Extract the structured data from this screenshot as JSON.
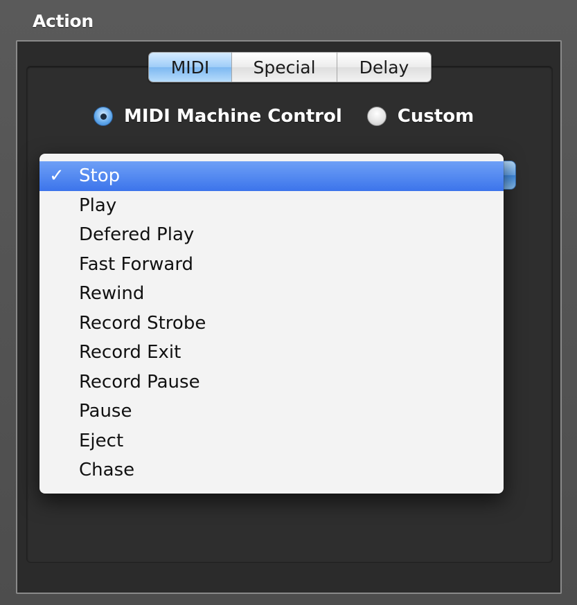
{
  "section": {
    "title": "Action"
  },
  "tabs": {
    "items": [
      {
        "label": "MIDI",
        "selected": true
      },
      {
        "label": "Special",
        "selected": false
      },
      {
        "label": "Delay",
        "selected": false
      }
    ]
  },
  "radio_group": {
    "options": [
      {
        "label": "MIDI Machine Control",
        "checked": true
      },
      {
        "label": "Custom",
        "checked": false
      }
    ]
  },
  "menu": {
    "check_mark": "✓",
    "selected_index": 0,
    "items": [
      "Stop",
      "Play",
      "Defered Play",
      "Fast Forward",
      "Rewind",
      "Record Strobe",
      "Record Exit",
      "Record Pause",
      "Pause",
      "Eject",
      "Chase"
    ]
  },
  "colors": {
    "panel_bg": "#555555",
    "highlight": "#3c74eb",
    "text_light": "#ffffff",
    "menu_bg": "#fafafa"
  }
}
